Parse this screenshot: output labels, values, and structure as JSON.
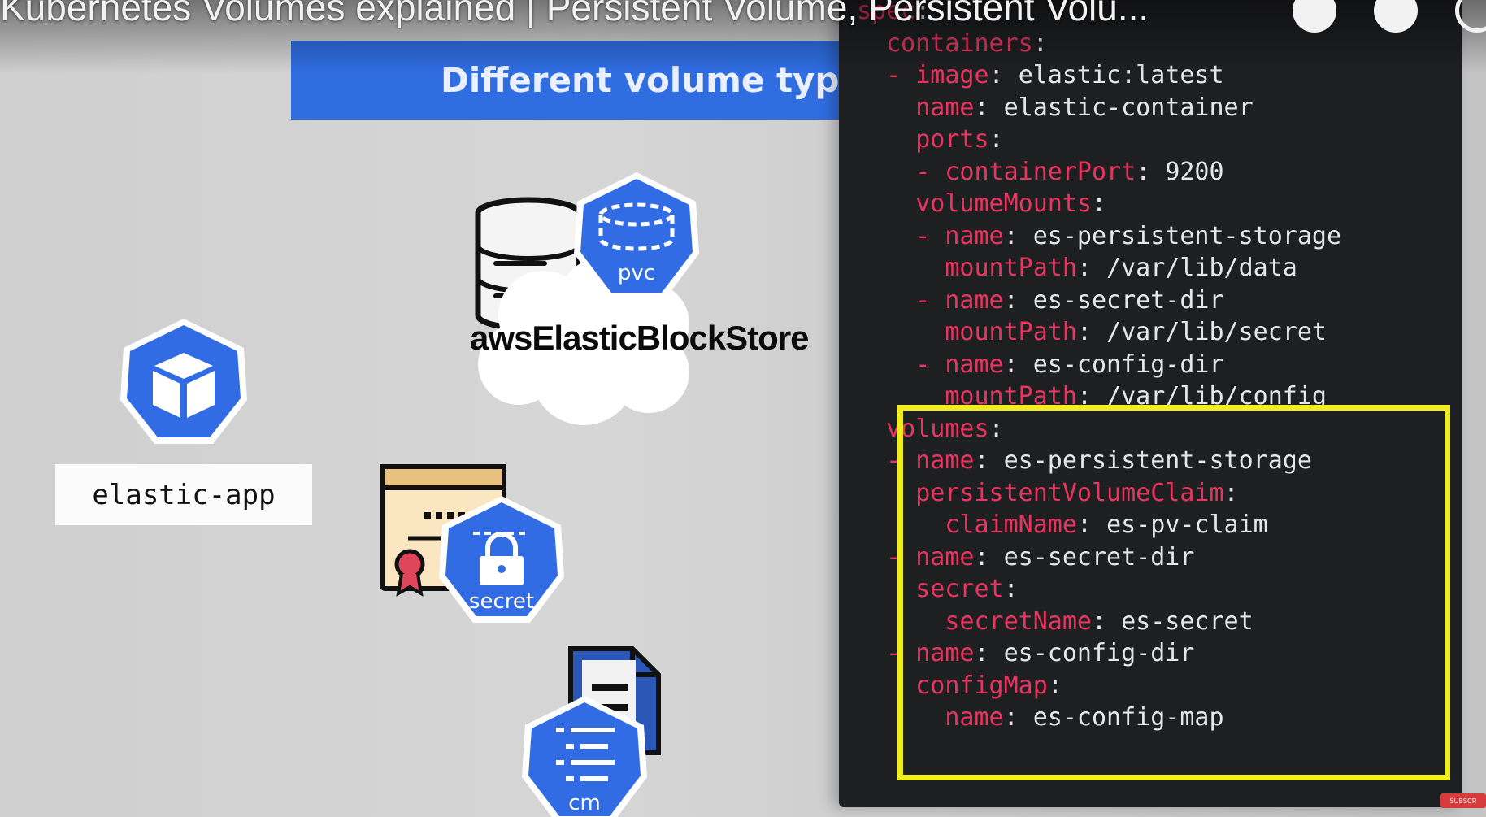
{
  "video": {
    "title": "Kubernetes Volumes explained | Persistent Volume, Persistent Volu..."
  },
  "slide": {
    "banner": "Different volume types",
    "app_label": "elastic-app",
    "aws_label": "awsElasticBlockStore",
    "pvc_label": "pvc",
    "secret_label": "secret",
    "cm_label": "cm"
  },
  "code": {
    "lines": [
      {
        "indent": "",
        "key": "spec",
        "sep": ":",
        "val": ""
      },
      {
        "indent": "  ",
        "key": "containers",
        "sep": ":",
        "val": ""
      },
      {
        "indent": "  - ",
        "key": "image",
        "sep": ": ",
        "val": "elastic:latest"
      },
      {
        "indent": "    ",
        "key": "name",
        "sep": ": ",
        "val": "elastic-container"
      },
      {
        "indent": "    ",
        "key": "ports",
        "sep": ":",
        "val": ""
      },
      {
        "indent": "    - ",
        "key": "containerPort",
        "sep": ": ",
        "val": "9200"
      },
      {
        "indent": "    ",
        "key": "volumeMounts",
        "sep": ":",
        "val": ""
      },
      {
        "indent": "    - ",
        "key": "name",
        "sep": ": ",
        "val": "es-persistent-storage"
      },
      {
        "indent": "      ",
        "key": "mountPath",
        "sep": ": ",
        "val": "/var/lib/data"
      },
      {
        "indent": "    - ",
        "key": "name",
        "sep": ": ",
        "val": "es-secret-dir"
      },
      {
        "indent": "      ",
        "key": "mountPath",
        "sep": ": ",
        "val": "/var/lib/secret"
      },
      {
        "indent": "    - ",
        "key": "name",
        "sep": ": ",
        "val": "es-config-dir"
      },
      {
        "indent": "      ",
        "key": "mountPath",
        "sep": ": ",
        "val": "/var/lib/config"
      },
      {
        "indent": "  ",
        "key": "volumes",
        "sep": ":",
        "val": ""
      },
      {
        "indent": "  - ",
        "key": "name",
        "sep": ": ",
        "val": "es-persistent-storage"
      },
      {
        "indent": "    ",
        "key": "persistentVolumeClaim",
        "sep": ":",
        "val": ""
      },
      {
        "indent": "      ",
        "key": "claimName",
        "sep": ": ",
        "val": "es-pv-claim"
      },
      {
        "indent": "  - ",
        "key": "name",
        "sep": ": ",
        "val": "es-secret-dir"
      },
      {
        "indent": "    ",
        "key": "secret",
        "sep": ":",
        "val": ""
      },
      {
        "indent": "      ",
        "key": "secretName",
        "sep": ": ",
        "val": "es-secret"
      },
      {
        "indent": "  - ",
        "key": "name",
        "sep": ": ",
        "val": "es-config-dir"
      },
      {
        "indent": "    ",
        "key": "configMap",
        "sep": ":",
        "val": ""
      },
      {
        "indent": "      ",
        "key": "name",
        "sep": ": ",
        "val": "es-config-map"
      }
    ]
  },
  "badges": {
    "subscribe": "SUBSCR"
  },
  "colors": {
    "k8s_blue": "#326ce5",
    "banner": "#2f6de1",
    "yaml_key": "#e8345f",
    "highlight": "#f1ee1e"
  }
}
